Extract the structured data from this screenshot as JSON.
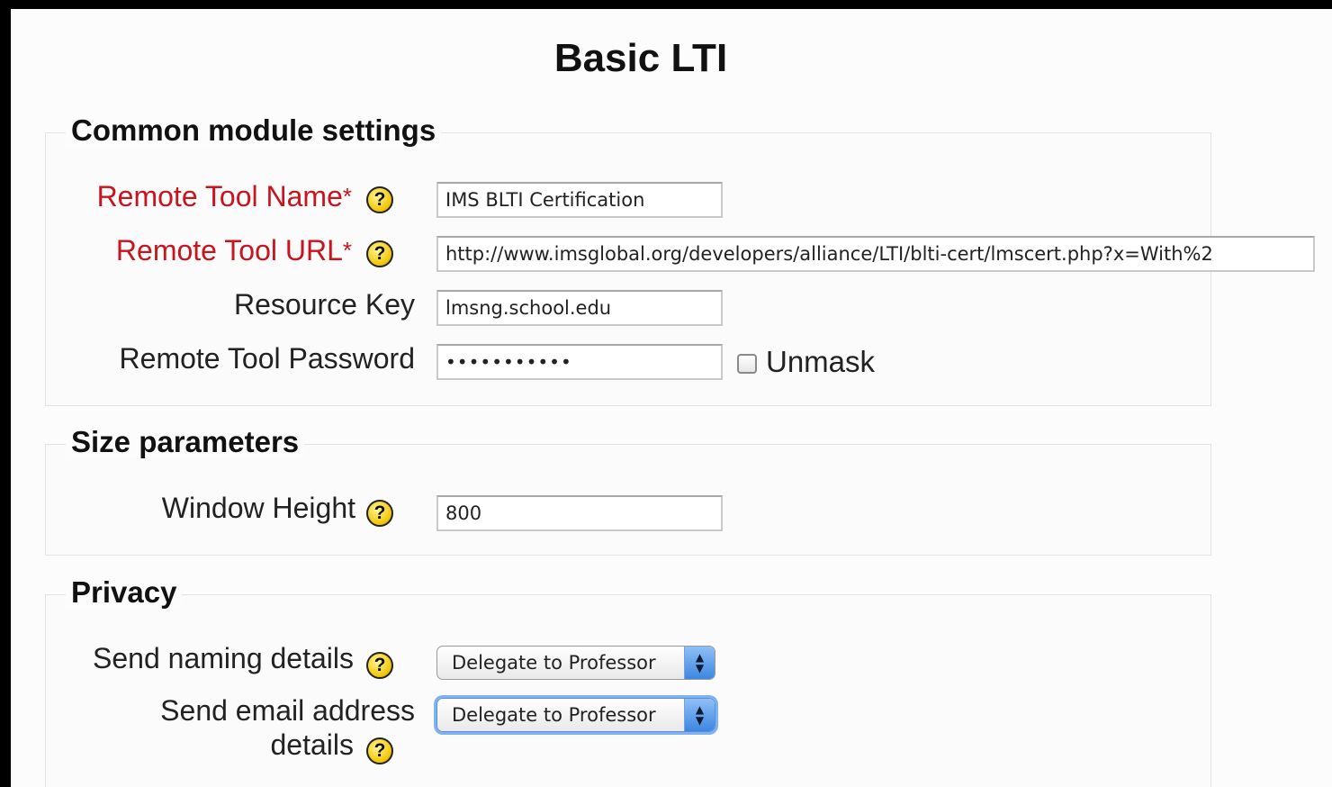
{
  "page": {
    "title": "Basic LTI"
  },
  "common": {
    "legend": "Common module settings",
    "tool_name": {
      "label": "Remote Tool Name",
      "required_mark": "*",
      "value": "IMS BLTI Certification"
    },
    "tool_url": {
      "label": "Remote Tool URL",
      "required_mark": "*",
      "value": "http://www.imsglobal.org/developers/alliance/LTI/blti-cert/lmscert.php?x=With%2"
    },
    "resource_key": {
      "label": "Resource Key",
      "value": "lmsng.school.edu"
    },
    "password": {
      "label": "Remote Tool Password",
      "value": "•••••••••••",
      "unmask_label": "Unmask",
      "unmask_checked": false
    }
  },
  "size": {
    "legend": "Size parameters",
    "window_height": {
      "label": "Window Height",
      "value": "800"
    }
  },
  "privacy": {
    "legend": "Privacy",
    "naming": {
      "label": "Send naming details",
      "selected": "Delegate to Professor"
    },
    "email": {
      "label_line1": "Send email address",
      "label_line2": "details",
      "selected": "Delegate to Professor"
    }
  },
  "icons": {
    "help": "help-icon",
    "select_arrows": "up-down-arrows-icon"
  },
  "colors": {
    "required": "#c8141e",
    "help_icon": "#f2c80c",
    "focus_ring": "#7fb2ee"
  }
}
